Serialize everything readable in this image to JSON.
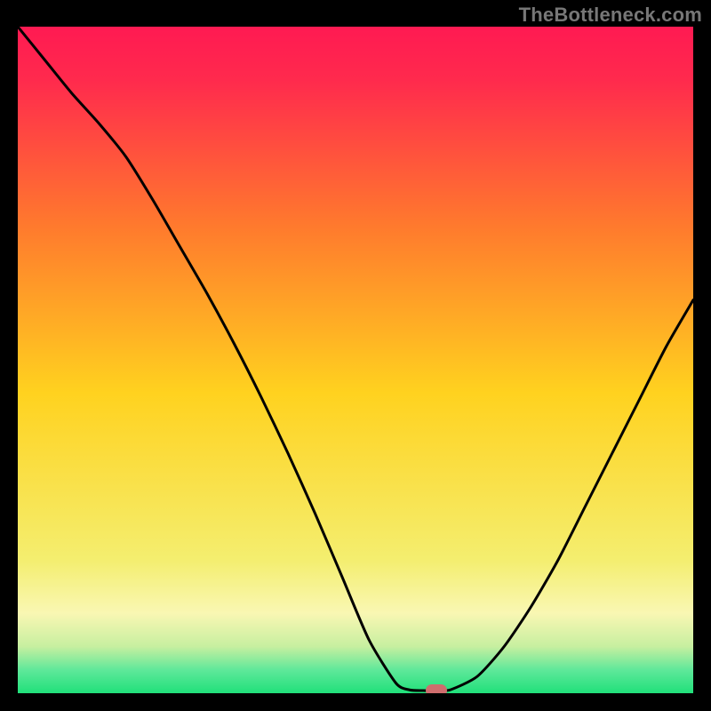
{
  "watermark": "TheBottleneck.com",
  "colors": {
    "frame_bg": "#000000",
    "grad_top": "#ff1a52",
    "grad_mid": "#ffd21f",
    "grad_low": "#f9f7b3",
    "grad_bottom": "#20e07a",
    "curve": "#000000",
    "marker": "#cf6d6d",
    "watermark": "#777777"
  },
  "chart_data": {
    "type": "line",
    "title": "",
    "xlabel": "",
    "ylabel": "",
    "xlim": [
      0,
      100
    ],
    "ylim": [
      0,
      100
    ],
    "x": [
      0,
      4,
      8,
      12,
      16,
      20,
      24,
      28,
      32,
      36,
      40,
      44,
      48,
      52,
      56,
      58,
      60,
      62,
      64,
      68,
      72,
      76,
      80,
      84,
      88,
      92,
      96,
      100
    ],
    "values": [
      100,
      95,
      90,
      85.5,
      80.5,
      74,
      67,
      60,
      52.5,
      44.5,
      36,
      27,
      17.5,
      8,
      1.5,
      0.5,
      0.4,
      0.4,
      0.5,
      2.5,
      7,
      13,
      20,
      28,
      36,
      44,
      52,
      59
    ],
    "flat_segment_x": [
      56,
      64
    ],
    "marker": {
      "x": 62,
      "y": 0.4
    },
    "gradient_stops": [
      {
        "offset": 0.0,
        "color": "#ff1a52"
      },
      {
        "offset": 0.08,
        "color": "#ff2a4d"
      },
      {
        "offset": 0.3,
        "color": "#ff7a2d"
      },
      {
        "offset": 0.55,
        "color": "#ffd21f"
      },
      {
        "offset": 0.8,
        "color": "#f4ee6f"
      },
      {
        "offset": 0.88,
        "color": "#f9f7b3"
      },
      {
        "offset": 0.93,
        "color": "#c7efa0"
      },
      {
        "offset": 0.965,
        "color": "#5fe89a"
      },
      {
        "offset": 1.0,
        "color": "#20e07a"
      }
    ]
  }
}
